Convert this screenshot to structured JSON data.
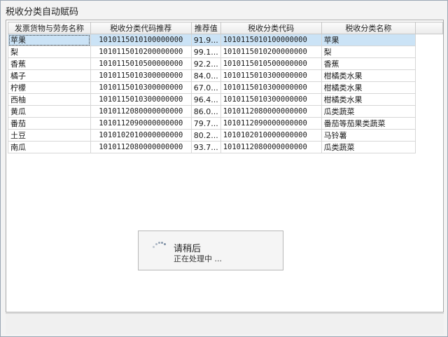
{
  "window": {
    "title": "税收分类自动赋码"
  },
  "table": {
    "columns": [
      "发票货物与劳务名称",
      "税收分类代码推荐",
      "推荐值",
      "税收分类代码",
      "税收分类名称"
    ],
    "rows": [
      [
        "苹果",
        "1010115010100000000",
        "91.9...",
        "1010115010100000000",
        "苹果"
      ],
      [
        "梨",
        "1010115010200000000",
        "99.1...",
        "1010115010200000000",
        "梨"
      ],
      [
        "香蕉",
        "1010115010500000000",
        "92.2...",
        "1010115010500000000",
        "香蕉"
      ],
      [
        "橘子",
        "1010115010300000000",
        "84.0...",
        "1010115010300000000",
        "柑橘类水果"
      ],
      [
        "柠檬",
        "1010115010300000000",
        "67.0...",
        "1010115010300000000",
        "柑橘类水果"
      ],
      [
        "西柚",
        "1010115010300000000",
        "96.4...",
        "1010115010300000000",
        "柑橘类水果"
      ],
      [
        "黄瓜",
        "1010112080000000000",
        "86.0...",
        "1010112080000000000",
        "瓜类蔬菜"
      ],
      [
        "番茄",
        "1010112090000000000",
        "79.7...",
        "1010112090000000000",
        "番茄等茄果类蔬菜"
      ],
      [
        "土豆",
        "1010102010000000000",
        "80.2...",
        "1010102010000000000",
        "马铃薯"
      ],
      [
        "南瓜",
        "1010112080000000000",
        "93.7...",
        "1010112080000000000",
        "瓜类蔬菜"
      ]
    ],
    "selected_row": 0
  },
  "wait_dialog": {
    "title": "请稍后",
    "message": "正在处理中 ..."
  },
  "colors": {
    "selection": "#cbe3f6",
    "border": "#9aa7b5"
  }
}
